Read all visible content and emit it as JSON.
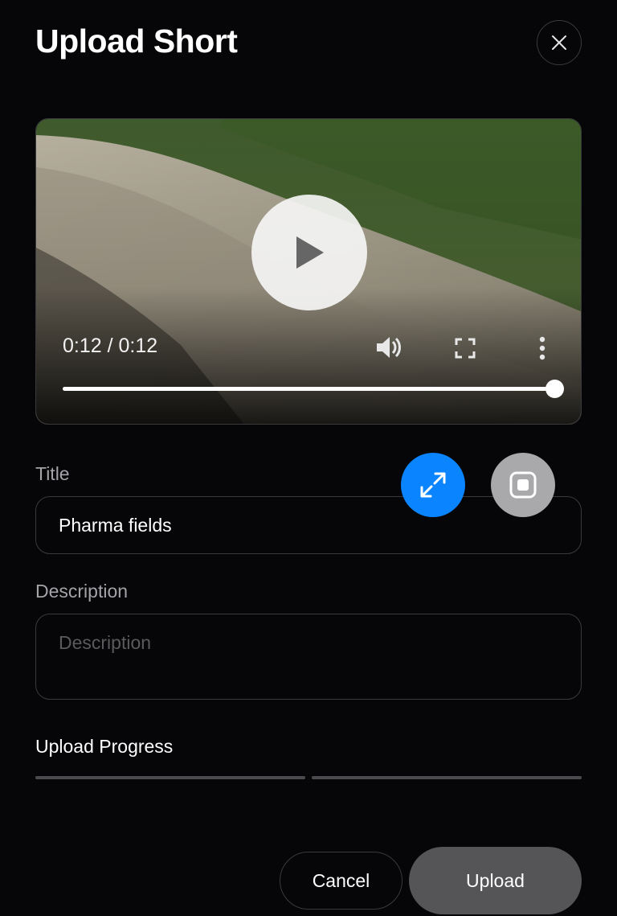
{
  "dialog": {
    "title": "Upload Short",
    "close_icon": "close-icon"
  },
  "video": {
    "time_display": "0:12 / 0:12",
    "progress_fraction": 1.0,
    "icons": {
      "play": "play-icon",
      "volume": "volume-icon",
      "fullscreen": "fullscreen-icon",
      "more": "more-vertical-icon"
    }
  },
  "form": {
    "title_label": "Title",
    "title_value": "Pharma fields",
    "description_label": "Description",
    "description_placeholder": "Description",
    "description_value": ""
  },
  "floating_buttons": {
    "expand_icon": "expand-icon",
    "stop_icon": "stop-icon",
    "expand_color": "#0a84ff",
    "stop_color": "#a9a9ab"
  },
  "upload": {
    "progress_label": "Upload Progress",
    "segments": [
      {
        "fraction": 0
      },
      {
        "fraction": 0
      }
    ]
  },
  "actions": {
    "cancel_label": "Cancel",
    "upload_label": "Upload"
  }
}
